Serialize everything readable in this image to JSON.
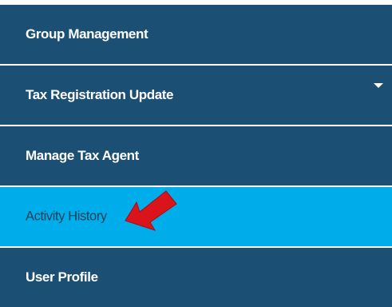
{
  "sidebar": {
    "items": [
      {
        "label": "Group Management"
      },
      {
        "label": "Tax Registration Update"
      },
      {
        "label": "Manage Tax Agent"
      },
      {
        "label": "Activity History"
      },
      {
        "label": "User Profile"
      }
    ]
  },
  "colors": {
    "menu_background": "#1b4f73",
    "active_background": "#00adeb",
    "annotation_arrow": "#d9141b"
  },
  "icons": {
    "expand": "chevron-down-icon",
    "annotation": "red-arrow-icon"
  }
}
